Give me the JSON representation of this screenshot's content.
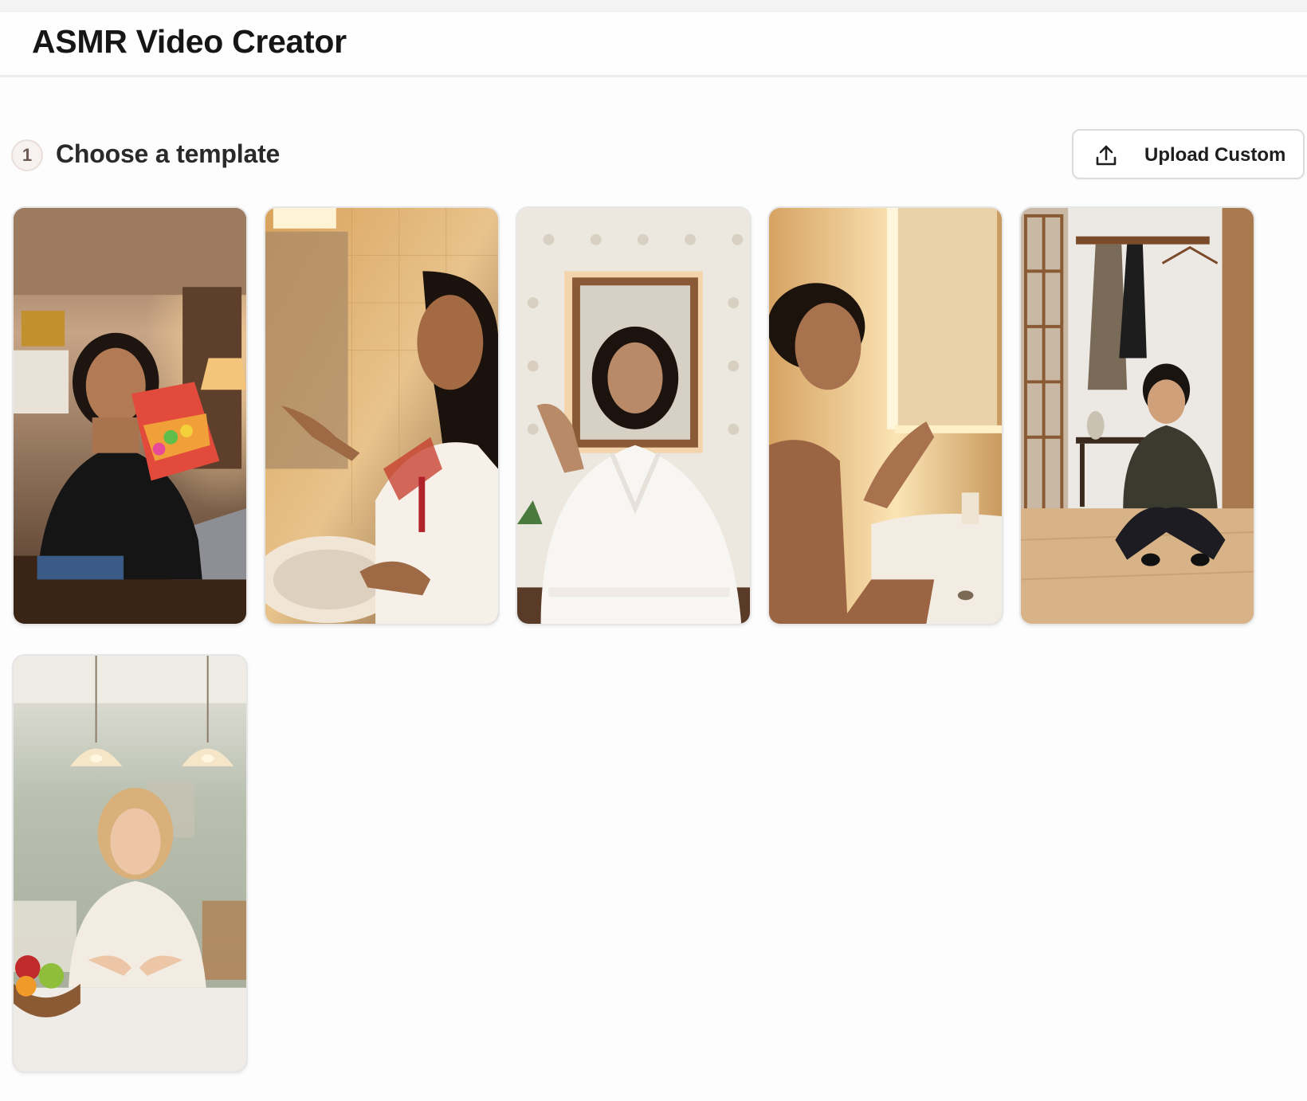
{
  "header": {
    "title": "ASMR Video Creator"
  },
  "section": {
    "step_number": "1",
    "title": "Choose a template"
  },
  "upload_button": {
    "label": "Upload Custom",
    "icon": "upload-icon"
  },
  "templates": [
    {
      "scene": "bedroom-candy-bag"
    },
    {
      "scene": "bathroom-embroidered-blouse"
    },
    {
      "scene": "mirror-bathrobe"
    },
    {
      "scene": "bathroom-vanity-light"
    },
    {
      "scene": "hallway-crouching-man"
    },
    {
      "scene": "kitchen-table-fruit-bowl"
    }
  ],
  "colors": {
    "badge_bg": "#f7f1ef",
    "border": "#dcdcdc",
    "text": "#1a1a1a"
  }
}
